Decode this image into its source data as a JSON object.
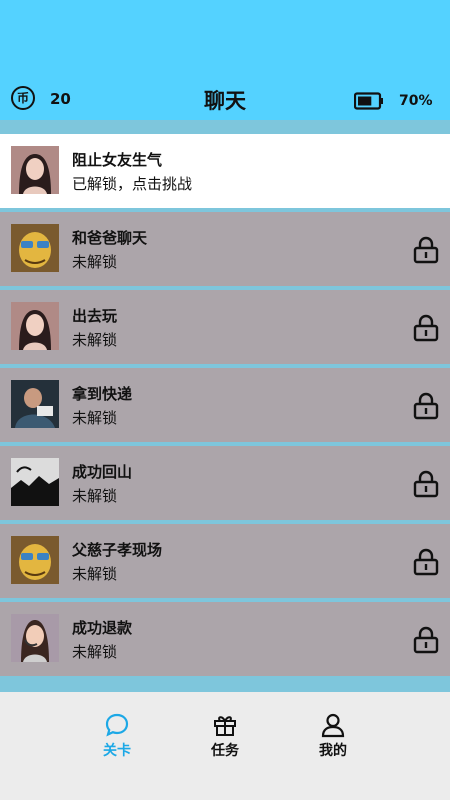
{
  "header": {
    "title": "聊天",
    "coin_icon_text": "币",
    "coin_count": "20",
    "battery_percent": "70%",
    "battery_level": 0.7
  },
  "levels": [
    {
      "name": "阻止女友生气",
      "status": "已解锁，点击挑战",
      "locked": false,
      "thumb": "girl-portrait"
    },
    {
      "name": "和爸爸聊天",
      "status": "未解锁",
      "locked": true,
      "thumb": "cartoon-dad"
    },
    {
      "name": "出去玩",
      "status": "未解锁",
      "locked": true,
      "thumb": "girl-portrait"
    },
    {
      "name": "拿到快递",
      "status": "未解锁",
      "locked": true,
      "thumb": "man-photo"
    },
    {
      "name": "成功回山",
      "status": "未解锁",
      "locked": true,
      "thumb": "mountain-silhouette"
    },
    {
      "name": "父慈子孝现场",
      "status": "未解锁",
      "locked": true,
      "thumb": "cartoon-dad"
    },
    {
      "name": "成功退款",
      "status": "未解锁",
      "locked": true,
      "thumb": "support-agent"
    }
  ],
  "tabs": [
    {
      "label": "关卡",
      "icon": "chat-bubble-icon",
      "active": true
    },
    {
      "label": "任务",
      "icon": "gift-icon",
      "active": false
    },
    {
      "label": "我的",
      "icon": "user-icon",
      "active": false
    }
  ],
  "colors": {
    "header_bg": "#54d2ff",
    "list_bg": "#7ec6dc",
    "locked_row_bg": "#aca5aa",
    "unlocked_row_bg": "#ffffff",
    "active_tab": "#1ca8e6"
  }
}
